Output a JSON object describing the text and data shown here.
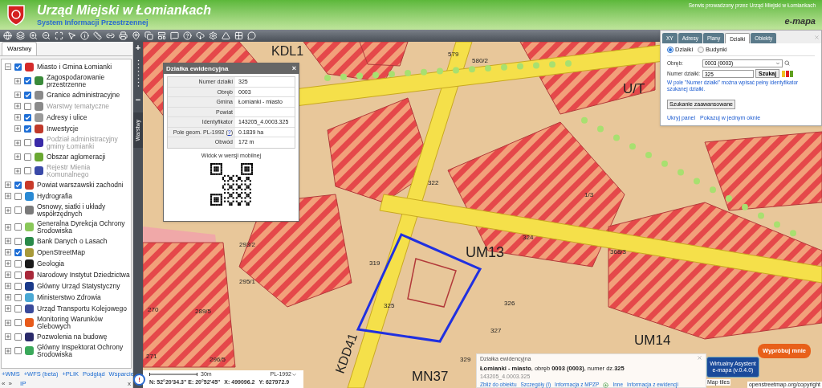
{
  "header": {
    "title": "Urząd Miejski w Łomiankach",
    "subtitle": "System Informacji Przestrzennej",
    "operator": "Serwis prowadzony przez Urząd Miejski w Łomiankach",
    "brand": "e-mapa"
  },
  "layers_panel": {
    "tab": "Warstwy",
    "layers": [
      {
        "label": "Miasto i Gmina Łomianki",
        "checked": true,
        "expanded": true,
        "disabled": false,
        "color": "#d42a2a",
        "children": [
          {
            "label": "Zagospodarowanie przestrzenne",
            "checked": true,
            "expanded": false,
            "disabled": false,
            "color": "#3a8a3a"
          },
          {
            "label": "Granice administracyjne",
            "checked": true,
            "expanded": false,
            "disabled": false,
            "color": "#8a8a8a"
          },
          {
            "label": "Warstwy tematyczne",
            "checked": false,
            "expanded": false,
            "disabled": true,
            "color": "#8a8a8a"
          },
          {
            "label": "Adresy i ulice",
            "checked": true,
            "expanded": false,
            "disabled": false,
            "color": "#9a9a9a"
          },
          {
            "label": "Inwestycje",
            "checked": true,
            "expanded": false,
            "disabled": false,
            "color": "#c0392b"
          },
          {
            "label": "Podział administracyjny gminy Łomianki",
            "checked": false,
            "expanded": false,
            "disabled": true,
            "color": "#3a2aa8"
          },
          {
            "label": "Obszar aglomeracji",
            "checked": false,
            "expanded": false,
            "disabled": false,
            "color": "#6aa832"
          },
          {
            "label": "Rejestr Mienia Komunalnego",
            "checked": false,
            "expanded": false,
            "disabled": true,
            "color": "#3a4aa8"
          }
        ]
      },
      {
        "label": "Powiat warszawski zachodni",
        "checked": true,
        "expanded": false,
        "disabled": false,
        "color": "#c83a2a"
      },
      {
        "label": "Hydrografia",
        "checked": false,
        "expanded": false,
        "disabled": false,
        "color": "#2a8ad4"
      },
      {
        "label": "Osnowy, siatki i układy współrzędnych",
        "checked": false,
        "expanded": false,
        "disabled": false,
        "color": "#7a7a7a"
      },
      {
        "label": "Generalna Dyrekcja Ochrony Środowiska",
        "checked": false,
        "expanded": false,
        "disabled": false,
        "color": "#8ac85a"
      },
      {
        "label": "Bank Danych o Lasach",
        "checked": false,
        "expanded": false,
        "disabled": false,
        "color": "#2a8a4a"
      },
      {
        "label": "OpenStreetMap",
        "checked": true,
        "expanded": false,
        "disabled": false,
        "color": "#a89a3a"
      },
      {
        "label": "Geologia",
        "checked": false,
        "expanded": false,
        "disabled": false,
        "color": "#1a1a1a"
      },
      {
        "label": "Narodowy Instytut Dziedzictwa",
        "checked": false,
        "expanded": false,
        "disabled": false,
        "color": "#a8283a"
      },
      {
        "label": "Główny Urząd Statystyczny",
        "checked": false,
        "expanded": false,
        "disabled": false,
        "color": "#1a3a8a"
      },
      {
        "label": "Ministerstwo Zdrowia",
        "checked": false,
        "expanded": false,
        "disabled": false,
        "color": "#4aa8d4"
      },
      {
        "label": "Urząd Transportu Kolejowego",
        "checked": false,
        "expanded": false,
        "disabled": false,
        "color": "#3a4a9a"
      },
      {
        "label": "Monitoring Warunków Glebowych",
        "checked": false,
        "expanded": false,
        "disabled": false,
        "color": "#e85a1a"
      },
      {
        "label": "Pozwolenia na budowę",
        "checked": false,
        "expanded": false,
        "disabled": false,
        "color": "#2a2a6a"
      },
      {
        "label": "Główny Inspektorat Ochrony Środowiska",
        "checked": false,
        "expanded": false,
        "disabled": false,
        "color": "#3aa85a"
      }
    ],
    "footer_links": [
      "+WMS",
      "+WFS (beta)",
      "+PLIK",
      "Podgląd",
      "Wsparcie"
    ],
    "footer_nav": [
      "«",
      "»"
    ],
    "ip": "IP",
    "close": "x"
  },
  "side_strip": {
    "zoom_in": "+",
    "zoom_out": "−",
    "tab": "Warstwy"
  },
  "map_labels": [
    {
      "text": "KDL1"
    },
    {
      "text": "UM13"
    },
    {
      "text": "UM14"
    },
    {
      "text": "U/T"
    },
    {
      "text": "MN37"
    },
    {
      "text": "KDD41"
    },
    {
      "text": "325"
    },
    {
      "text": "324"
    },
    {
      "text": "326"
    },
    {
      "text": "327"
    },
    {
      "text": "322"
    },
    {
      "text": "319"
    },
    {
      "text": "329"
    },
    {
      "text": "271"
    },
    {
      "text": "270"
    },
    {
      "text": "289/5"
    },
    {
      "text": "293/2"
    },
    {
      "text": "296/5"
    },
    {
      "text": "295/1"
    },
    {
      "text": "368/3"
    },
    {
      "text": "1/3"
    },
    {
      "text": "579"
    },
    {
      "text": "580/2"
    }
  ],
  "popup": {
    "title": "Działka ewidencyjna",
    "close": "×",
    "rows": [
      {
        "label": "Numer działki",
        "value": "325"
      },
      {
        "label": "Obręb",
        "value": "0003"
      },
      {
        "label": "Gmina",
        "value": "Łomianki - miasto"
      },
      {
        "label": "Powiat"
      },
      {
        "label": "Identyfikator",
        "value": "143205_4.0003.325"
      },
      {
        "label": "Pole geom. PL-1992",
        "help_open": "(",
        "help_link": "?",
        "help_close": ")",
        "value": "0.1839 ha"
      },
      {
        "label": "Obwód",
        "value": "172 m"
      }
    ],
    "mobile_caption": "Widok w wersji mobilnej"
  },
  "search_panel": {
    "tabs": [
      {
        "label": "XY",
        "selected": false
      },
      {
        "label": "Adresy",
        "selected": false
      },
      {
        "label": "Plany",
        "selected": false
      },
      {
        "label": "Działki",
        "selected": true
      },
      {
        "label": "Obiekty",
        "selected": false
      }
    ],
    "modes": [
      {
        "label": "Działki",
        "selected": true
      },
      {
        "label": "Budynki",
        "selected": false
      }
    ],
    "precinct_label": "Obręb:",
    "precinct_value": "0003 (0003)",
    "parcel_label": "Numer działki:",
    "parcel_value": "325",
    "search_button": "Szukaj",
    "swatches": [
      {
        "color": "#f0c020"
      },
      {
        "color": "#e02020"
      },
      {
        "color": "#60a020"
      }
    ],
    "hint": "W pole \"Numer działki\" można wpisać pełny identyfikator szukanej działki.",
    "advanced_button": "Szukanie zaawansowane",
    "links": [
      "Ukryj panel",
      "Pokazuj w jednym oknie"
    ]
  },
  "info_panel": {
    "title": "Działka ewidencyjna",
    "summary": "**Łomianki - miasto**, obręb **0003 (0003)**, numer dz.**325**",
    "identifier": "143205_4.0003.325",
    "links": [
      "Zbliż do obiektu",
      "Szczegóły (I)",
      "Informacja z MPZP",
      "Inne",
      "Informacja z ewidencji"
    ]
  },
  "try_button": "Wypróbuj mnie",
  "assistant_button": "Wirtualny Asystent e-mapa (v.0.4.0)",
  "attribution": {
    "tiles": "Map tiles",
    "copyright": "openstreetmap.org/copyright"
  },
  "status": {
    "alert": "!",
    "scale": "30m",
    "crs": "PL-1992",
    "geo": "N: 52°20'34.3\" E: 20°52'45\"",
    "x": "X: 499096.2",
    "y": "Y: 627972.9"
  }
}
